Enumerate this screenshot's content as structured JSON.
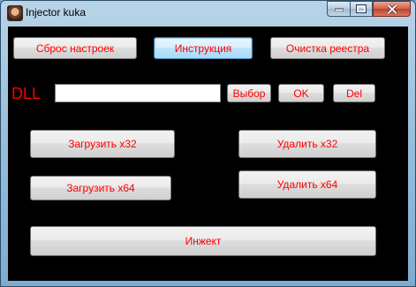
{
  "window": {
    "title": "Injector kuka",
    "icon": "app-avatar-icon",
    "controls": {
      "minimize": "minimize-icon",
      "maximize": "maximize-icon",
      "close": "close-icon"
    }
  },
  "toolbar": {
    "reset_label": "Сброс настроек",
    "instructions_label": "Инструкция",
    "clean_registry_label": "Очистка реестра"
  },
  "dll": {
    "label": "DLL",
    "path_value": "",
    "browse_label": "Выбор",
    "ok_label": "OK",
    "del_label": "Del"
  },
  "actions": {
    "load_x32": "Загрузить x32",
    "delete_x32": "Удалить x32",
    "load_x64": "Загрузить x64",
    "delete_x64": "Удалить x64",
    "inject": "Инжект"
  },
  "colors": {
    "client_background": "#000000",
    "button_text": "#ff0000"
  }
}
